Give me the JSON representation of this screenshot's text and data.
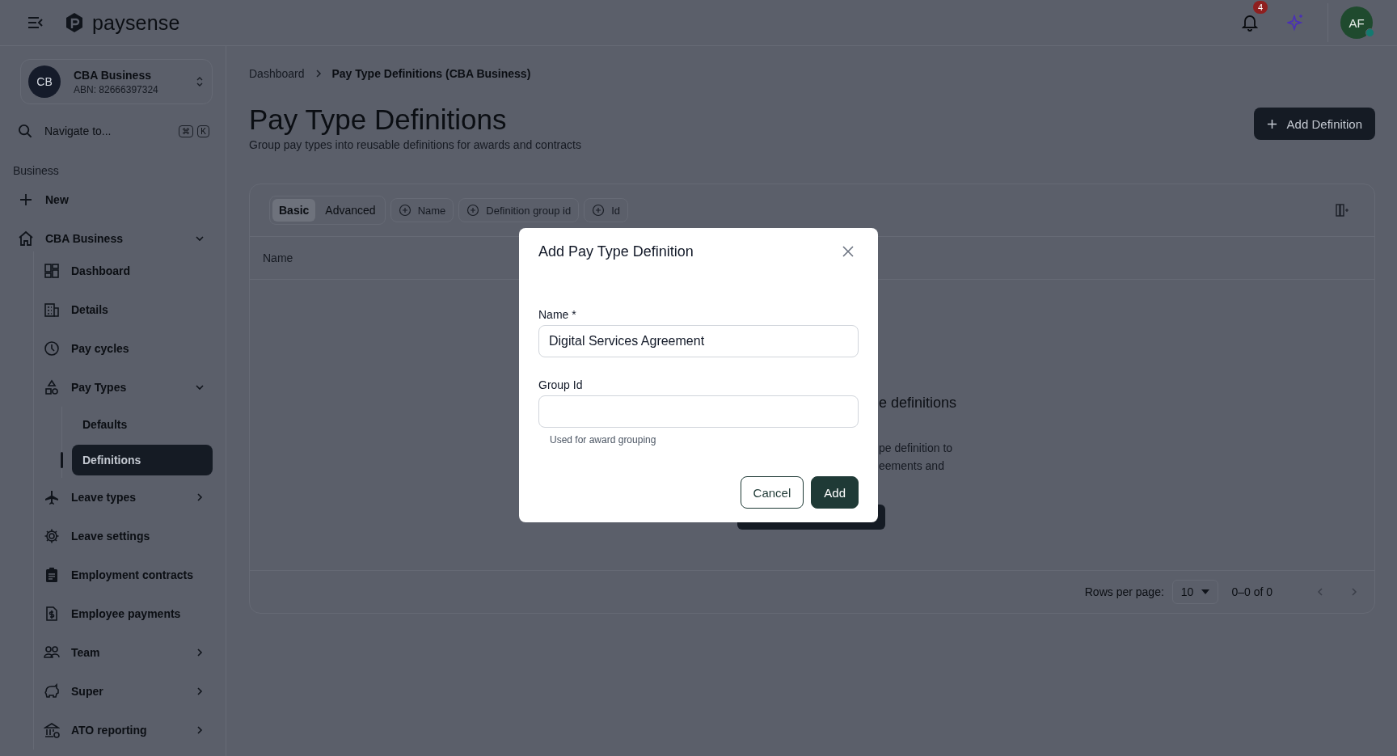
{
  "header": {
    "logo": "paysense",
    "notification_count": "4",
    "avatar": "AF"
  },
  "business_switcher": {
    "initials": "CB",
    "name": "CBA Business",
    "abn": "ABN: 82666397324"
  },
  "search": {
    "placeholder": "Navigate to...",
    "shortcut": [
      "⌘",
      "K"
    ]
  },
  "sidebar": {
    "section": "Business",
    "new_label": "New",
    "items": [
      {
        "label": "CBA Business",
        "expanded": true,
        "children": [
          {
            "label": "Dashboard"
          },
          {
            "label": "Details"
          },
          {
            "label": "Pay cycles"
          },
          {
            "label": "Pay Types",
            "expanded": true,
            "children": [
              {
                "label": "Defaults",
                "selected": false
              },
              {
                "label": "Definitions",
                "selected": true
              }
            ]
          },
          {
            "label": "Leave types",
            "expanded": false
          },
          {
            "label": "Leave settings"
          },
          {
            "label": "Employment contracts"
          },
          {
            "label": "Employee payments"
          },
          {
            "label": "Team",
            "expanded": false
          },
          {
            "label": "Super",
            "expanded": false
          },
          {
            "label": "ATO reporting",
            "expanded": false
          }
        ]
      }
    ]
  },
  "breadcrumb": [
    "Dashboard",
    "Pay Type Definitions (CBA Business)"
  ],
  "page": {
    "title": "Pay Type Definitions",
    "subtitle": "Group pay types into reusable definitions for awards and contracts",
    "action": "Add Definition"
  },
  "filter_modes": [
    {
      "label": "Basic",
      "selected": true
    },
    {
      "label": "Advanced",
      "selected": false
    }
  ],
  "filter_chips": [
    "Name",
    "Definition group id",
    "Id"
  ],
  "table": {
    "columns": [
      "Name"
    ],
    "empty_state": {
      "heading": "e definitions",
      "lines": [
        "pe definition to",
        "eements and"
      ]
    }
  },
  "pagination": {
    "rows_per_page_label": "Rows per page:",
    "rows_per_page": "10",
    "range": "0–0 of 0"
  },
  "dialog": {
    "title": "Add Pay Type Definition",
    "fields": [
      {
        "label": "Name *",
        "value": "Digital Services Agreement"
      },
      {
        "label": "Group Id",
        "hint": "Used for award grouping"
      }
    ],
    "buttons": [
      {
        "label": "Cancel",
        "kind": "secondary"
      },
      {
        "label": "Add",
        "kind": "primary"
      }
    ]
  }
}
